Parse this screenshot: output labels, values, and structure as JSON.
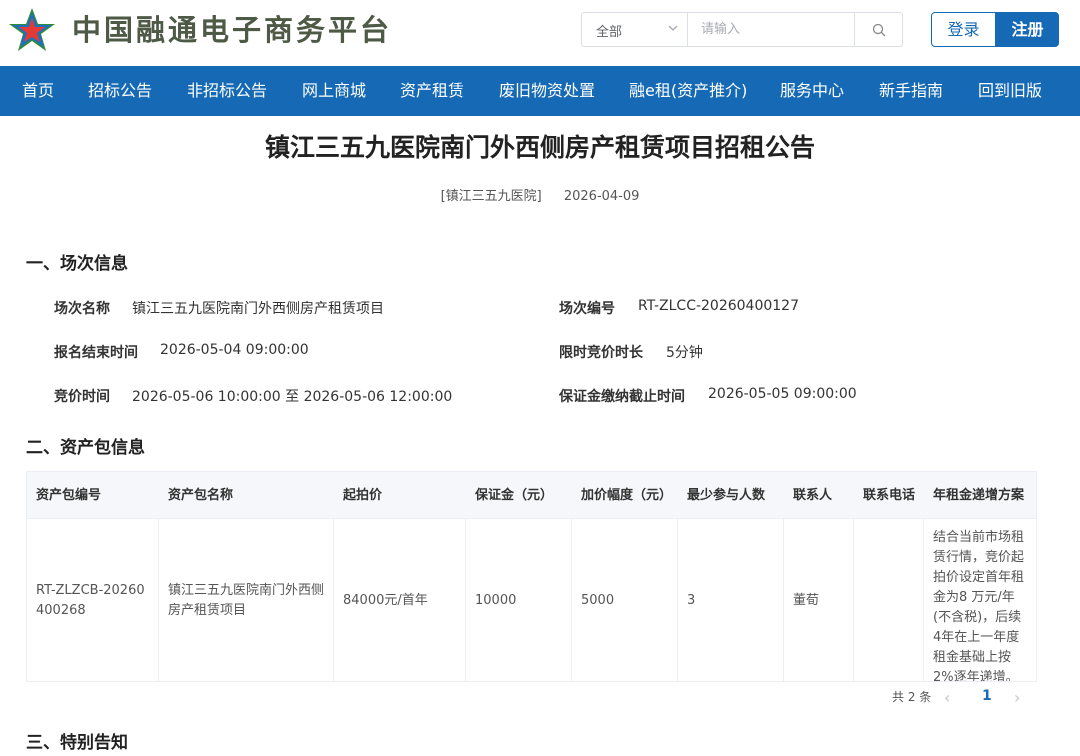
{
  "header": {
    "site_name": "中国融通电子商务平台",
    "search_category": "全部",
    "search_placeholder": "请输入",
    "login_label": "登录",
    "register_label": "注册"
  },
  "nav": {
    "items": [
      "首页",
      "招标公告",
      "非招标公告",
      "网上商城",
      "资产租赁",
      "废旧物资处置",
      "融e租(资产推介)",
      "服务中心",
      "新手指南",
      "回到旧版"
    ]
  },
  "article": {
    "title": "镇江三五九医院南门外西侧房产租赁项目招租公告",
    "source": "[镇江三五九医院]",
    "date": "2026-04-09"
  },
  "session": {
    "heading": "一、场次信息",
    "name_label": "场次名称",
    "name_value": "镇江三五九医院南门外西侧房产租赁项目",
    "code_label": "场次编号",
    "code_value": "RT-ZLCC-20260400127",
    "signup_end_label": "报名结束时间",
    "signup_end_value": "2026-05-04 09:00:00",
    "time_limit_label": "限时竞价时长",
    "time_limit_value": "5分钟",
    "bid_time_label": "竞价时间",
    "bid_time_value": "2026-05-06 10:00:00 至 2026-05-06 12:00:00",
    "deposit_deadline_label": "保证金缴纳截止时间",
    "deposit_deadline_value": "2026-05-05 09:00:00"
  },
  "package": {
    "heading": "二、资产包信息",
    "columns": [
      "资产包编号",
      "资产包名称",
      "起拍价",
      "保证金（元）",
      "加价幅度（元）",
      "最少参与人数",
      "联系人",
      "联系电话",
      "年租金递增方案"
    ],
    "row": {
      "code": "RT-ZLZCB-20260400268",
      "name": "镇江三五九医院南门外西侧房产租赁项目",
      "start_price": "84000元/首年",
      "deposit": "10000",
      "increment": "5000",
      "min_participants": "3",
      "contact": "董荀",
      "phone": "",
      "rent_plan": "结合当前市场租赁行情，竞价起拍价设定首年租金为8 万元/年(不含税)，后续4年在上一年度租金基础上按2%逐年递增。"
    },
    "pager": {
      "total": "共 2 条",
      "current_page": "1"
    }
  },
  "notice": {
    "heading": "三、特别告知"
  },
  "colors": {
    "primary": "#1569b5",
    "logo_text": "#4e5a46",
    "logo_red": "#e53935",
    "logo_green": "#2e8b3a",
    "logo_blue": "#1f6fc1"
  }
}
